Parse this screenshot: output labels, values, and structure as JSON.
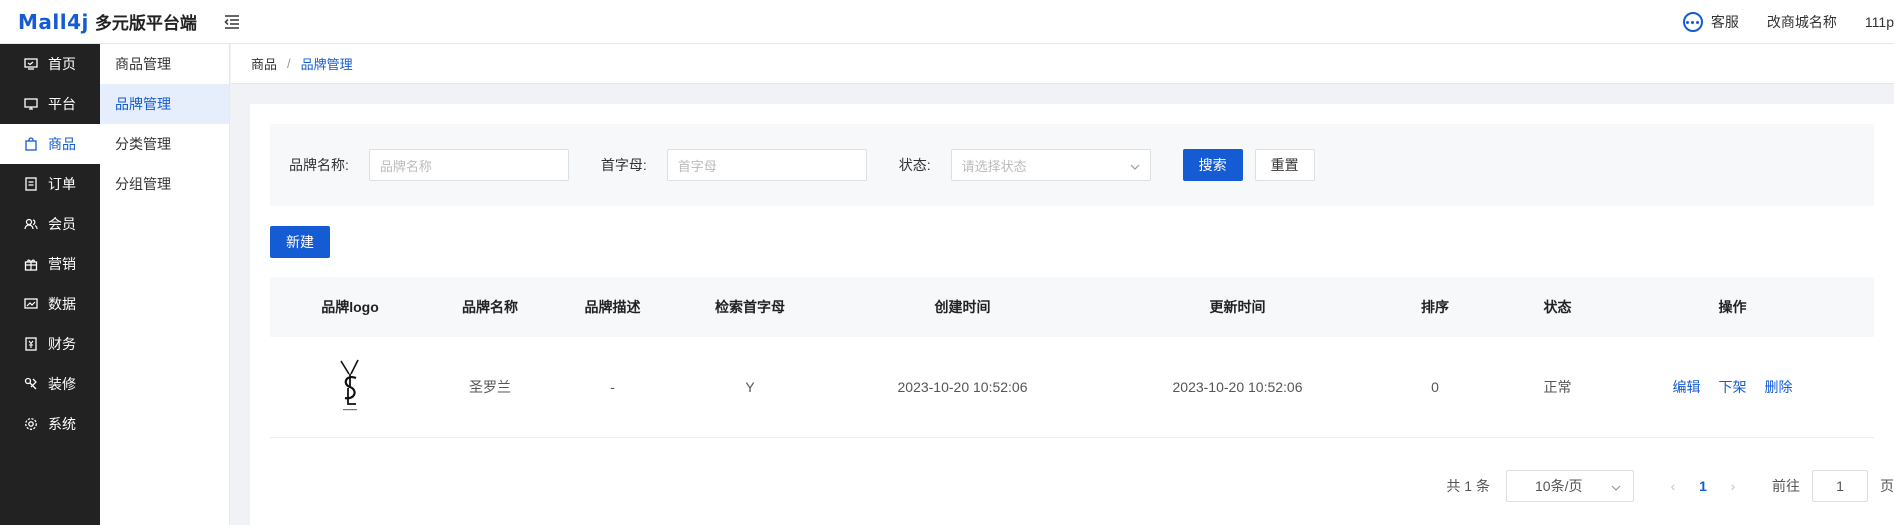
{
  "header": {
    "logo_mark": "Mall4j",
    "logo_text": "多元版平台端",
    "customer_service": "客服",
    "shop_name": "改商城名称",
    "user": "111p"
  },
  "sidebar": {
    "items": [
      {
        "label": "首页",
        "icon": "home-icon"
      },
      {
        "label": "平台",
        "icon": "monitor-icon"
      },
      {
        "label": "商品",
        "icon": "bag-icon",
        "active": true
      },
      {
        "label": "订单",
        "icon": "document-icon"
      },
      {
        "label": "会员",
        "icon": "users-icon"
      },
      {
        "label": "营销",
        "icon": "gift-icon"
      },
      {
        "label": "数据",
        "icon": "chart-icon"
      },
      {
        "label": "财务",
        "icon": "finance-icon"
      },
      {
        "label": "装修",
        "icon": "paint-icon"
      },
      {
        "label": "系统",
        "icon": "gear-icon"
      }
    ]
  },
  "subnav": {
    "items": [
      {
        "label": "商品管理"
      },
      {
        "label": "品牌管理",
        "active": true
      },
      {
        "label": "分类管理"
      },
      {
        "label": "分组管理"
      }
    ]
  },
  "breadcrumb": {
    "parent": "商品",
    "separator": "/",
    "current": "品牌管理"
  },
  "search": {
    "brand_name_label": "品牌名称:",
    "brand_name_placeholder": "品牌名称",
    "initial_label": "首字母:",
    "initial_placeholder": "首字母",
    "status_label": "状态:",
    "status_placeholder": "请选择状态",
    "search_button": "搜索",
    "reset_button": "重置"
  },
  "actions": {
    "new_button": "新建"
  },
  "table": {
    "columns": [
      "品牌logo",
      "品牌名称",
      "品牌描述",
      "检索首字母",
      "创建时间",
      "更新时间",
      "排序",
      "状态",
      "操作"
    ],
    "rows": [
      {
        "name": "圣罗兰",
        "description": "-",
        "initial": "Y",
        "created": "2023-10-20 10:52:06",
        "updated": "2023-10-20 10:52:06",
        "sort": "0",
        "status": "正常",
        "ops": [
          "编辑",
          "下架",
          "删除"
        ]
      }
    ]
  },
  "pagination": {
    "total": "共 1 条",
    "page_size": "10条/页",
    "current_page": "1",
    "goto_label": "前往",
    "goto_value": "1",
    "page_suffix": "页"
  },
  "colors": {
    "primary": "#155bd4",
    "sidebar_bg": "#222222"
  }
}
